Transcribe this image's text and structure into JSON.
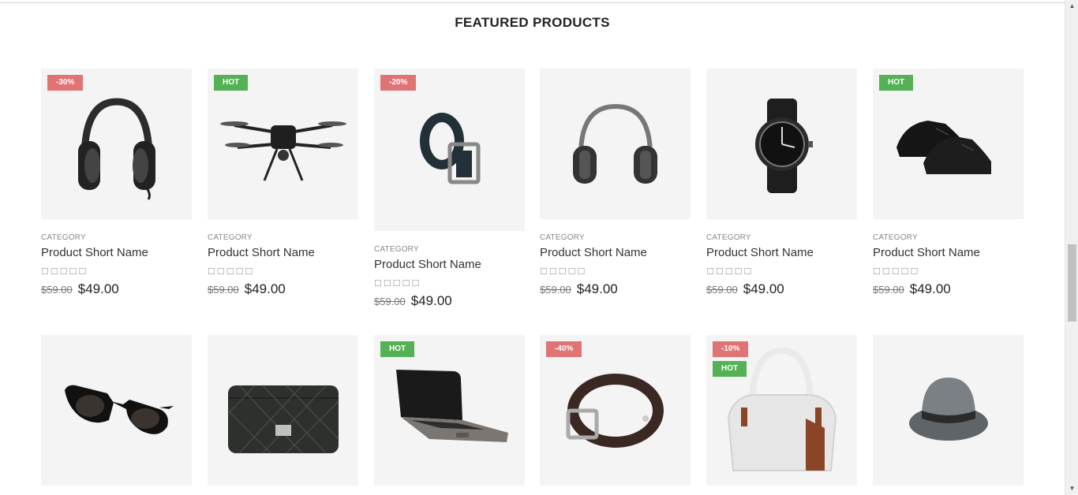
{
  "section": {
    "title": "FEATURED PRODUCTS"
  },
  "products_row1": [
    {
      "category": "CATEGORY",
      "name": "Product Short Name",
      "old_price": "$59.00",
      "price": "$49.00",
      "badges": [
        "-30%"
      ],
      "image": "headphones"
    },
    {
      "category": "CATEGORY",
      "name": "Product Short Name",
      "old_price": "$59.00",
      "price": "$49.00",
      "badges": [
        "HOT"
      ],
      "image": "drone"
    },
    {
      "category": "CATEGORY",
      "name": "Product Short Name",
      "old_price": "$59.00",
      "price": "$49.00",
      "badges": [
        "-20%"
      ],
      "image": "belt"
    },
    {
      "category": "CATEGORY",
      "name": "Product Short Name",
      "old_price": "$59.00",
      "price": "$49.00",
      "badges": [],
      "image": "earmuffs"
    },
    {
      "category": "CATEGORY",
      "name": "Product Short Name",
      "old_price": "$59.00",
      "price": "$49.00",
      "badges": [],
      "image": "wristwatch"
    },
    {
      "category": "CATEGORY",
      "name": "Product Short Name",
      "old_price": "$59.00",
      "price": "$49.00",
      "badges": [
        "HOT"
      ],
      "image": "shoes"
    }
  ],
  "products_row2": [
    {
      "badges": [],
      "image": "sunglasses"
    },
    {
      "badges": [],
      "image": "quilted-handbag"
    },
    {
      "badges": [
        "HOT"
      ],
      "image": "laptop"
    },
    {
      "badges": [
        "-40%"
      ],
      "image": "leather-belt"
    },
    {
      "badges": [
        "-10%",
        "HOT"
      ],
      "image": "white-handbag"
    },
    {
      "badges": [],
      "image": "fedora-hat"
    }
  ],
  "rating": {
    "stars_text": "☐☐☐☐☐",
    "value": 0
  },
  "colors": {
    "sale_badge": "#e07474",
    "hot_badge": "#55b155",
    "thumb_bg": "#f4f4f4"
  }
}
